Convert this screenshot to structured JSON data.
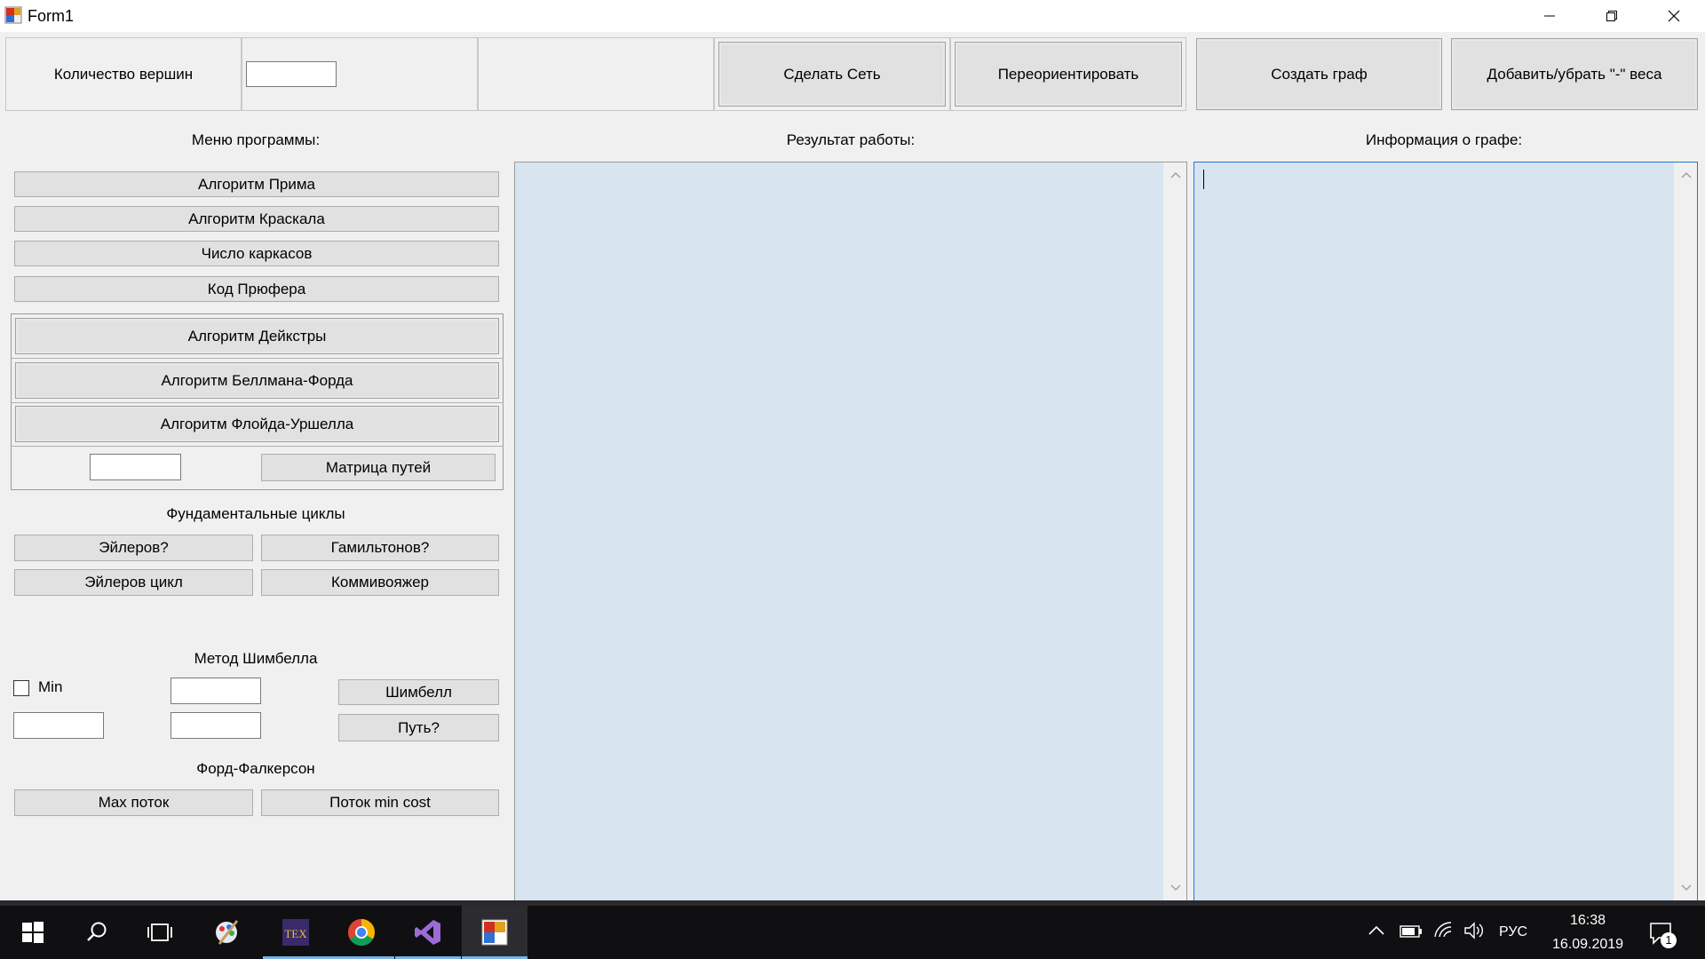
{
  "window": {
    "title": "Form1",
    "icon": "winforms-app-icon",
    "controls": [
      "minimize-icon",
      "restore-icon",
      "close-icon"
    ]
  },
  "toolbar": {
    "vertex_count_label": "Количество вершин",
    "vertex_count_value": "",
    "make_network": "Сделать Сеть",
    "reorient": "Переориентировать",
    "create_graph": "Создать граф",
    "toggle_negative_weights": "Добавить/убрать \"-\" веса"
  },
  "menu": {
    "heading": "Меню программы:",
    "prim": "Алгоритм Прима",
    "kruskal": "Алгоритм Краскала",
    "spanning_count": "Число каркасов",
    "prufer": "Код Прюфера",
    "dijkstra": "Алгоритм Дейкстры",
    "bellman_ford": "Алгоритм Беллмана-Форда",
    "floyd_warshall": "Алгоритм Флойда-Уршелла",
    "path_value": "",
    "path_matrix": "Матрица путей",
    "fundamental_cycles": "Фундаментальные циклы",
    "euler_q": "Эйлеров?",
    "hamilton_q": "Гамильтонов?",
    "euler_cycle": "Эйлеров цикл",
    "salesman": "Коммивояжер",
    "shimbell_heading": "Метод Шимбелла",
    "min_label": "Min",
    "min_checked": false,
    "shimbell_value_1": "",
    "shimbell_value_2": "",
    "shimbell_value_3": "",
    "shimbell": "Шимбелл",
    "path_q": "Путь?",
    "ford_heading": "Форд-Фалкерсон",
    "max_flow": "Max поток",
    "min_cost_flow": "Поток min cost"
  },
  "result": {
    "heading": "Результат работы:",
    "text": ""
  },
  "info": {
    "heading": "Информация о графе:",
    "text": ""
  },
  "taskbar": {
    "apps": [
      "start-icon",
      "search-icon",
      "task-view-icon",
      "paint-app-icon",
      "tex-app-icon",
      "chrome-icon",
      "visual-studio-icon",
      "form-app-icon"
    ],
    "tex_text": "TEX",
    "language": "РУС",
    "time": "16:38",
    "date": "16.09.2019",
    "notifications": "1"
  }
}
